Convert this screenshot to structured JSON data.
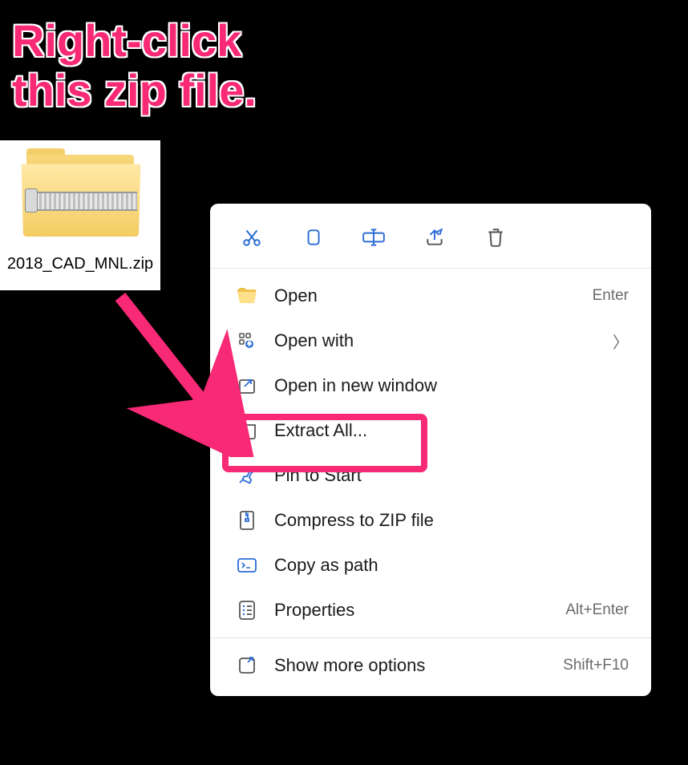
{
  "annotation": {
    "line1": "Right-click",
    "line2": "this zip file."
  },
  "file": {
    "name": "2018_CAD_MNL.zip"
  },
  "toolbar": {
    "icons": [
      "cut",
      "copy",
      "rename",
      "share",
      "delete"
    ]
  },
  "menu": {
    "open": {
      "label": "Open",
      "shortcut": "Enter"
    },
    "open_with": {
      "label": "Open with"
    },
    "open_new_window": {
      "label": "Open in new window"
    },
    "extract_all": {
      "label": "Extract All..."
    },
    "pin_start": {
      "label": "Pin to Start"
    },
    "compress_zip": {
      "label": "Compress to ZIP file"
    },
    "copy_path": {
      "label": "Copy as path"
    },
    "properties": {
      "label": "Properties",
      "shortcut": "Alt+Enter"
    },
    "show_more": {
      "label": "Show more options",
      "shortcut": "Shift+F10"
    }
  }
}
